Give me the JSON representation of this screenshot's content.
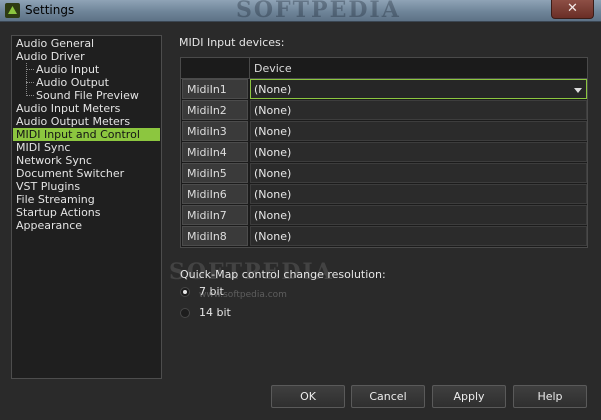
{
  "window": {
    "title": "Settings",
    "title_watermark": "SOFTPEDIA",
    "close_glyph": "✕"
  },
  "nav": {
    "items": [
      {
        "label": "Audio General",
        "child": false,
        "selected": false
      },
      {
        "label": "Audio Driver",
        "child": false,
        "selected": false
      },
      {
        "label": "Audio Input",
        "child": true,
        "selected": false
      },
      {
        "label": "Audio Output",
        "child": true,
        "selected": false
      },
      {
        "label": "Sound File Preview",
        "child": true,
        "selected": false
      },
      {
        "label": "Audio Input Meters",
        "child": false,
        "selected": false
      },
      {
        "label": "Audio Output Meters",
        "child": false,
        "selected": false
      },
      {
        "label": "MIDI Input and Control",
        "child": false,
        "selected": true
      },
      {
        "label": "MIDI Sync",
        "child": false,
        "selected": false
      },
      {
        "label": "Network Sync",
        "child": false,
        "selected": false
      },
      {
        "label": "Document Switcher",
        "child": false,
        "selected": false
      },
      {
        "label": "VST Plugins",
        "child": false,
        "selected": false
      },
      {
        "label": "File Streaming",
        "child": false,
        "selected": false
      },
      {
        "label": "Startup Actions",
        "child": false,
        "selected": false
      },
      {
        "label": "Appearance",
        "child": false,
        "selected": false
      }
    ]
  },
  "midi": {
    "section_label": "MIDI Input devices:",
    "column_header": "Device",
    "rows": [
      {
        "name": "MidiIn1",
        "device": "(None)"
      },
      {
        "name": "MidiIn2",
        "device": "(None)"
      },
      {
        "name": "MidiIn3",
        "device": "(None)"
      },
      {
        "name": "MidiIn4",
        "device": "(None)"
      },
      {
        "name": "MidiIn5",
        "device": "(None)"
      },
      {
        "name": "MidiIn6",
        "device": "(None)"
      },
      {
        "name": "MidiIn7",
        "device": "(None)"
      },
      {
        "name": "MidiIn8",
        "device": "(None)"
      }
    ]
  },
  "quickmap": {
    "label": "Quick-Map control change resolution:",
    "options": [
      {
        "label": "7 bit",
        "checked": true
      },
      {
        "label": "14 bit",
        "checked": false
      }
    ],
    "watermark": "SOFTPEDIA",
    "watermark_url": "www.softpedia.com"
  },
  "buttons": {
    "ok": "OK",
    "cancel": "Cancel",
    "apply": "Apply",
    "help": "Help"
  },
  "colors": {
    "accent": "#8cc63f",
    "background": "#2a2a2a"
  },
  "icons": {
    "app": "app-logo-icon",
    "dropdown": "chevron-down-icon",
    "close": "close-icon"
  }
}
